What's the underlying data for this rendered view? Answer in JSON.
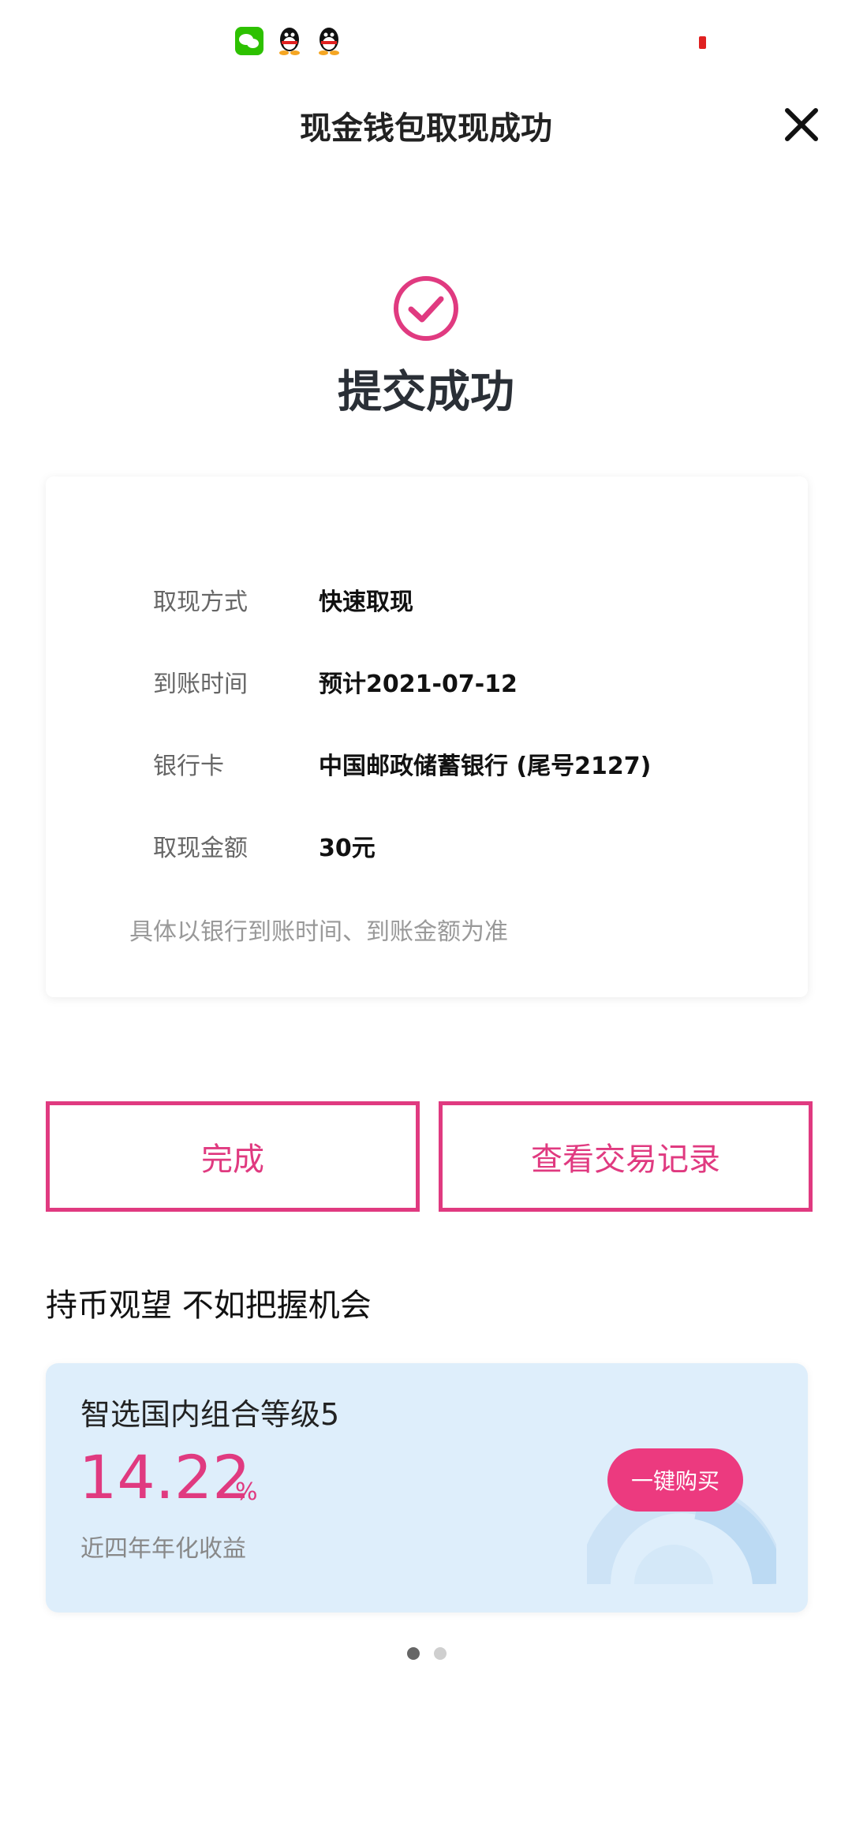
{
  "status_bar": {
    "icons": [
      "wechat-icon",
      "qq-icon",
      "qq-icon"
    ],
    "battery_color": "#e02020"
  },
  "header": {
    "title": "现金钱包取现成功",
    "close_icon": "close-icon"
  },
  "result": {
    "icon": "check-circle-icon",
    "title": "提交成功",
    "accent_color": "#e03a80"
  },
  "info": {
    "rows": [
      {
        "label": "取现方式",
        "value": "快速取现"
      },
      {
        "label": "到账时间",
        "value": "预计2021-07-12"
      },
      {
        "label": "银行卡",
        "value": "中国邮政储蓄银行 (尾号2127)"
      },
      {
        "label": "取现金额",
        "value": "30元"
      }
    ],
    "note": "具体以银行到账时间、到账金额为准"
  },
  "actions": {
    "done_label": "完成",
    "records_label": "查看交易记录"
  },
  "promo": {
    "heading": "持币观望 不如把握机会",
    "product_name": "智选国内组合等级5",
    "rate": "14.22",
    "rate_unit": "%",
    "rate_label": "近四年年化收益",
    "buy_label": "一键购买",
    "card_color": "#deeefb"
  },
  "pagination": {
    "total": 2,
    "active": 1
  }
}
